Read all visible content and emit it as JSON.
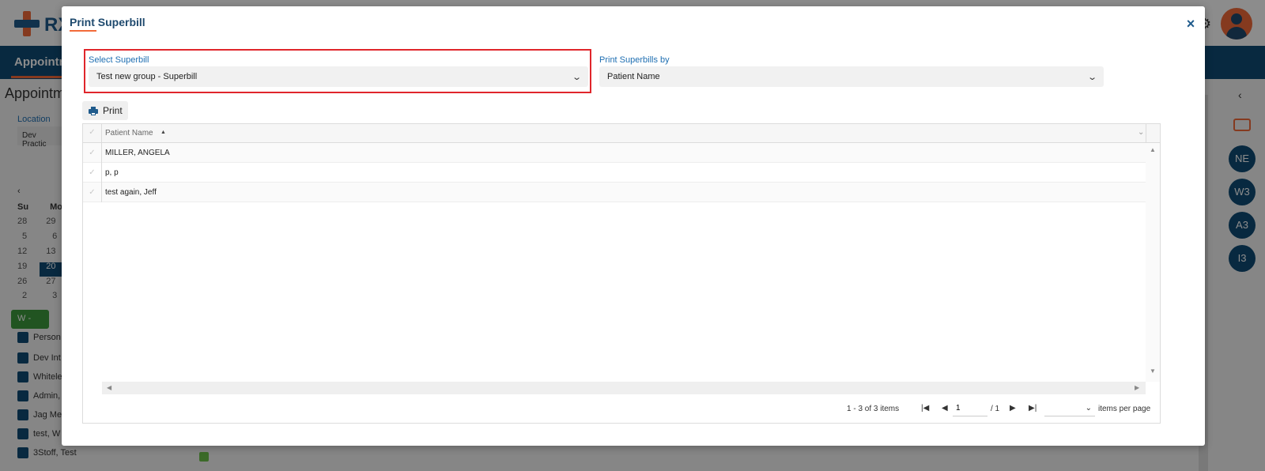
{
  "background": {
    "logo_text": "RX",
    "nav_label": "Appointm",
    "page_title": "Appointm",
    "location_label": "Location",
    "location_value": "Dev Practic",
    "calendar_headers": [
      "Su",
      "Mo"
    ],
    "calendar_rows": [
      [
        "28",
        "29"
      ],
      [
        "5",
        "6"
      ],
      [
        "12",
        "13"
      ],
      [
        "19",
        "20"
      ],
      [
        "26",
        "27"
      ],
      [
        "2",
        "3"
      ]
    ],
    "view_button": "W -",
    "checklist": [
      "Person",
      "Dev Int",
      "Whitele",
      "Admin,",
      "Jag Med",
      "test, W",
      "3Stoff, Test"
    ],
    "right_circles": [
      "NE",
      "W3",
      "A3",
      "I3"
    ]
  },
  "modal": {
    "title": "Print Superbill",
    "close_icon": "×",
    "select_superbill": {
      "label": "Select Superbill",
      "value": "Test new group - Superbill"
    },
    "print_by": {
      "label": "Print Superbills by",
      "value": "Patient Name"
    },
    "print_button": "Print",
    "grid": {
      "column_header": "Patient Name",
      "rows": [
        "MILLER, ANGELA",
        "p, p",
        "test again, Jeff"
      ]
    },
    "pager": {
      "info": "1 - 3 of 3 items",
      "page_value": "1",
      "of_pages": "/ 1",
      "items_per_page_label": "items per page"
    }
  },
  "colors": {
    "brand_blue": "#1f5b8c",
    "accent_orange": "#f26b3a",
    "highlight_red": "#e0262b",
    "label_blue": "#1f6fb2"
  }
}
